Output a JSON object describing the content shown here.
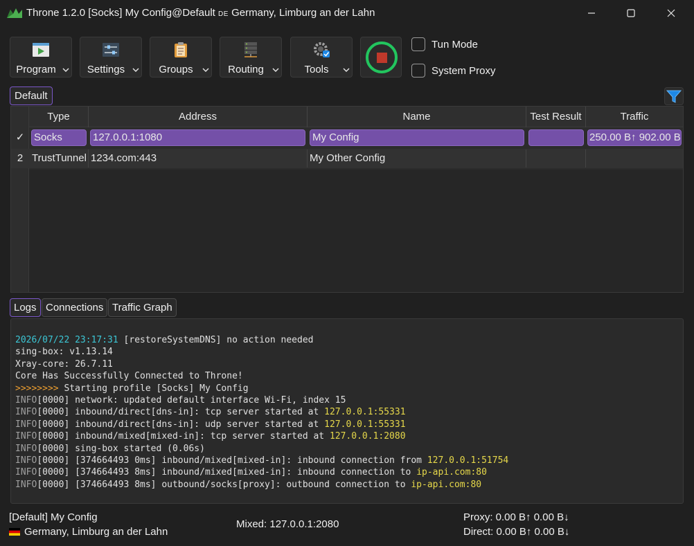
{
  "window": {
    "title_prefix": "Throne 1.2.0 [Socks] My Config@Default",
    "title_country_code": "DE",
    "title_location": "Germany, Limburg an der Lahn"
  },
  "toolbar": {
    "program_label": "Program",
    "settings_label": "Settings",
    "groups_label": "Groups",
    "routing_label": "Routing",
    "tools_label": "Tools",
    "tun_mode_label": "Tun Mode",
    "system_proxy_label": "System Proxy"
  },
  "group_tab": "Default",
  "table": {
    "headers": [
      "Type",
      "Address",
      "Name",
      "Test Result",
      "Traffic"
    ],
    "rows": [
      {
        "marker": "✓",
        "type": "Socks",
        "address": "127.0.0.1:1080",
        "name": "My Config",
        "test_result": "",
        "traffic": "250.00 B↑ 902.00 B↓"
      },
      {
        "marker": "2",
        "type": "TrustTunnel",
        "address": "1234.com:443",
        "name": "My Other Config",
        "test_result": "",
        "traffic": ""
      }
    ]
  },
  "log_tabs": [
    "Logs",
    "Connections",
    "Traffic Graph"
  ],
  "logs": {
    "l1_time": "2026/07/22 23:17:31",
    "l1_msg": " [restoreSystemDNS] no action needed",
    "l2": "sing-box: v1.13.14",
    "l3": "Xray-core: 26.7.11",
    "l4": "Core Has Successfully Connected to Throne!",
    "l5_arrows": ">>>>>>>>",
    "l5_msg": " Starting profile [Socks] My Config",
    "info": "INFO",
    "l6": "[0000] network: updated default interface Wi-Fi, index 15",
    "l7_msg": "[0000] inbound/direct[dns-in]: tcp server started at ",
    "l7_addr": "127.0.0.1:55331",
    "l8_msg": "[0000] inbound/direct[dns-in]: udp server started at ",
    "l8_addr": "127.0.0.1:55331",
    "l9_msg": "[0000] inbound/mixed[mixed-in]: tcp server started at ",
    "l9_addr": "127.0.0.1:2080",
    "l10": "[0000] sing-box started (0.06s)",
    "l11_msg": "[0000] [374664493 0ms] inbound/mixed[mixed-in]: inbound connection from ",
    "l11_addr": "127.0.0.1:51754",
    "l12_msg": "[0000] [374664493 8ms] inbound/mixed[mixed-in]: inbound connection to ",
    "l12_addr": "ip-api.com:80",
    "l13_msg": "[0000] [374664493 8ms] outbound/socks[proxy]: outbound connection to ",
    "l13_addr": "ip-api.com:80"
  },
  "status": {
    "profile": "[Default] My Config",
    "location": "Germany, Limburg an der Lahn",
    "mixed": "Mixed: 127.0.0.1:2080",
    "proxy": "Proxy: 0.00 B↑ 0.00 B↓",
    "direct": "Direct: 0.00 B↑ 0.00 B↓"
  },
  "colors": {
    "accent": "#7450a8",
    "running": "#22c55e",
    "stop": "#c0392b"
  },
  "icons": {
    "program": "program-icon",
    "settings": "settings-icon",
    "groups": "groups-icon",
    "routing": "routing-icon",
    "tools": "tools-icon",
    "filter": "filter-icon"
  }
}
